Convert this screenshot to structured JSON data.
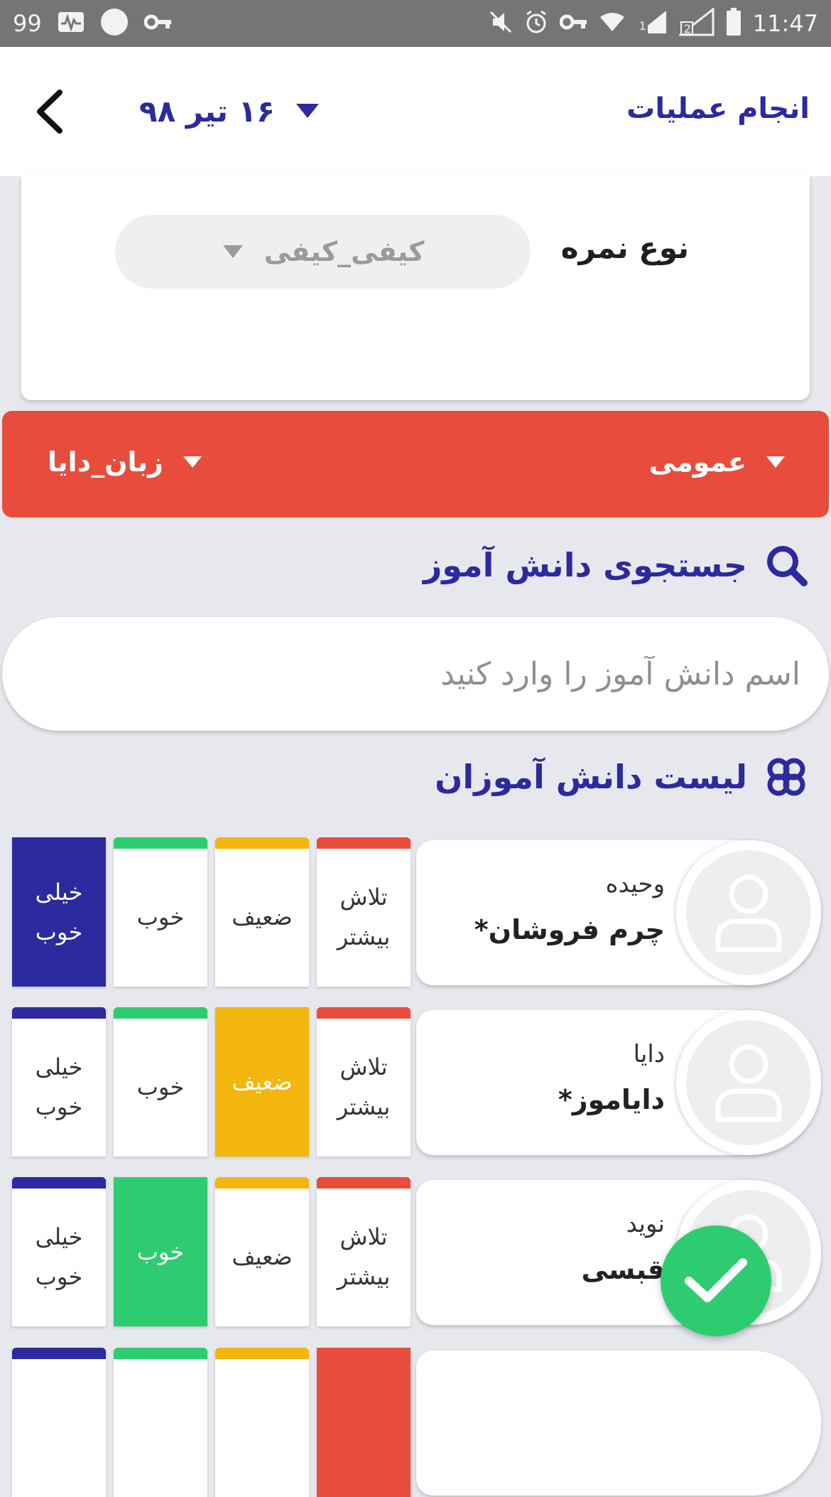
{
  "status_bar": {
    "left_number": "99",
    "time": "11:47",
    "sim1": "1",
    "sim2": "2"
  },
  "app_bar": {
    "title": "انجام عملیات",
    "date": "۱۶ تیر ۹۸"
  },
  "grade_type": {
    "label": "نوع نمره",
    "selected": "کیفی_کیفی"
  },
  "filters": {
    "right": "عمومی",
    "left": "زبان_دایا"
  },
  "search": {
    "heading": "جستجوی دانش آموز",
    "placeholder": "اسم دانش آموز را وارد کنید"
  },
  "list": {
    "heading": "لیست دانش آموزان"
  },
  "grade_options": [
    {
      "line1": "تلاش",
      "line2": "بیشتر",
      "color": "#e84c3d"
    },
    {
      "line1": "ضعیف",
      "line2": "",
      "color": "#f2b60f"
    },
    {
      "line1": "خوب",
      "line2": "",
      "color": "#2ecc71"
    },
    {
      "line1": "خیلی",
      "line2": "خوب",
      "color": "#2b2a9e"
    }
  ],
  "students": [
    {
      "first_name": "وحیده",
      "last_name": "چرم فروشان*",
      "selected_grade": 3
    },
    {
      "first_name": "دایا",
      "last_name": "دایاموز*",
      "selected_grade": 1
    },
    {
      "first_name": "نوید",
      "last_name": "قبسی",
      "selected_grade": 2
    }
  ],
  "colors": {
    "primary": "#2b2a9e",
    "accent_red": "#e84c3d",
    "yellow": "#f2b60f",
    "green": "#2ecc71",
    "background": "#e7e8ee"
  }
}
